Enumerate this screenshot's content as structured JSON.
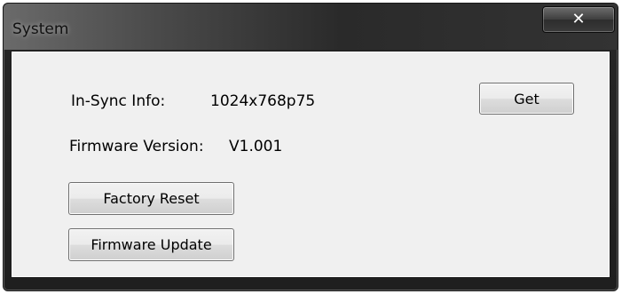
{
  "window": {
    "title": "System",
    "close_glyph": "✕"
  },
  "info": {
    "insync_label": "In-Sync Info:",
    "insync_value": "1024x768p75",
    "firmware_label": "Firmware Version:",
    "firmware_value": "V1.001"
  },
  "buttons": {
    "get": "Get",
    "factory_reset": "Factory Reset",
    "firmware_update": "Firmware Update"
  }
}
